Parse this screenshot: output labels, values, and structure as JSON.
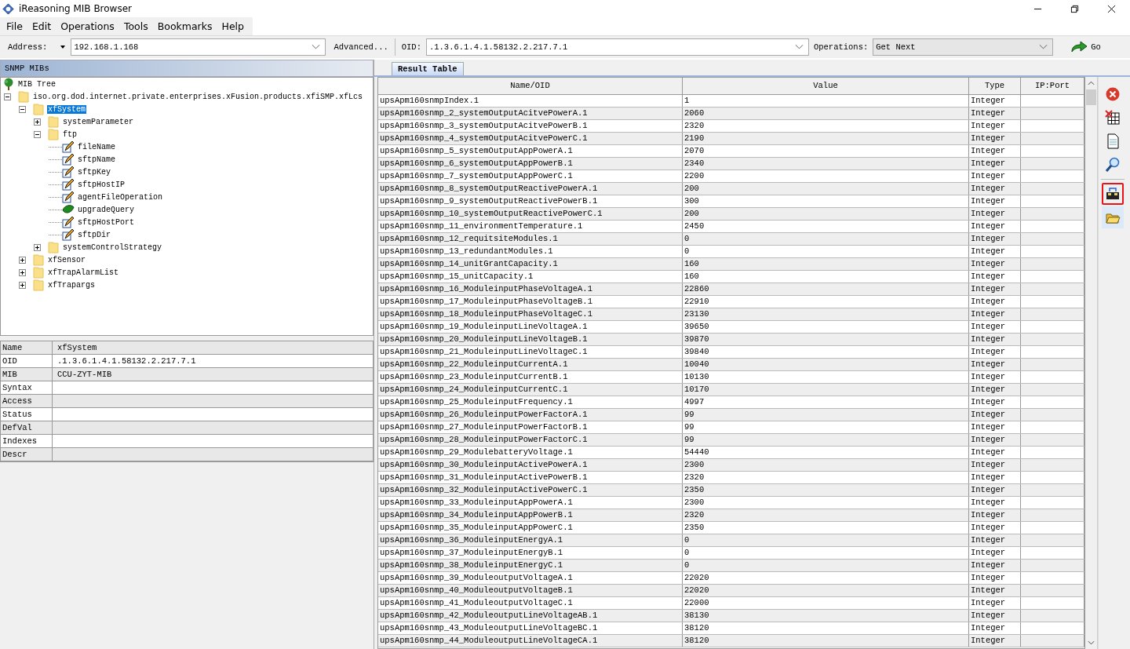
{
  "window": {
    "title": "iReasoning MIB Browser"
  },
  "menu": [
    "File",
    "Edit",
    "Operations",
    "Tools",
    "Bookmarks",
    "Help"
  ],
  "toolbar": {
    "address_label": "Address:",
    "address": "192.168.1.168",
    "advanced": "Advanced...",
    "oid_label": "OID:",
    "oid": ".1.3.6.1.4.1.58132.2.217.7.1",
    "operations_label": "Operations:",
    "operation": "Get Next",
    "go": "Go"
  },
  "mib_panel": {
    "title": "SNMP MIBs",
    "root": "MIB Tree",
    "tree": [
      {
        "label": "iso.org.dod.internet.private.enterprises.xFusion.products.xfiSMP.xfLcs",
        "kind": "folder",
        "expanded": true,
        "selected": false,
        "children": [
          {
            "label": "xfSystem",
            "kind": "folder",
            "expanded": true,
            "selected": true,
            "children": [
              {
                "label": "systemParameter",
                "kind": "folder",
                "expanded": false,
                "selected": false
              },
              {
                "label": "ftp",
                "kind": "folder",
                "expanded": true,
                "selected": false,
                "children": [
                  {
                    "label": "fileName",
                    "kind": "writable",
                    "selected": false
                  },
                  {
                    "label": "sftpName",
                    "kind": "writable",
                    "selected": false
                  },
                  {
                    "label": "sftpKey",
                    "kind": "writable",
                    "selected": false
                  },
                  {
                    "label": "sftpHostIP",
                    "kind": "writable",
                    "selected": false
                  },
                  {
                    "label": "agentFileOperation",
                    "kind": "writable",
                    "selected": false
                  },
                  {
                    "label": "upgradeQuery",
                    "kind": "readonly",
                    "selected": false
                  },
                  {
                    "label": "sftpHostPort",
                    "kind": "writable",
                    "selected": false
                  },
                  {
                    "label": "sftpDir",
                    "kind": "writable",
                    "selected": false
                  }
                ]
              },
              {
                "label": "systemControlStrategy",
                "kind": "folder",
                "expanded": false,
                "selected": false
              }
            ]
          },
          {
            "label": "xfSensor",
            "kind": "folder",
            "expanded": false,
            "selected": false
          },
          {
            "label": "xfTrapAlarmList",
            "kind": "folder",
            "expanded": false,
            "selected": false
          },
          {
            "label": "xfTrapargs",
            "kind": "folder",
            "expanded": false,
            "selected": false
          }
        ]
      }
    ]
  },
  "properties": [
    {
      "name": "Name",
      "value": "xfSystem"
    },
    {
      "name": "OID",
      "value": ".1.3.6.1.4.1.58132.2.217.7.1"
    },
    {
      "name": "MIB",
      "value": "CCU-ZYT-MIB"
    },
    {
      "name": "Syntax"
    },
    {
      "name": "Access"
    },
    {
      "name": "Status"
    },
    {
      "name": "DefVal"
    },
    {
      "name": "Indexes"
    },
    {
      "name": "Descr"
    }
  ],
  "result_tab": {
    "label": "Result Table",
    "selected": true
  },
  "table": {
    "columns": [
      "Name/OID",
      "Value",
      "Type",
      "IP:Port"
    ],
    "rows": [
      [
        "upsApm160snmpIndex.1",
        "1",
        "Integer"
      ],
      [
        "upsApm160snmp_2_systemOutputAcitvePowerA.1",
        "2060",
        "Integer"
      ],
      [
        "upsApm160snmp_3_systemOutputAcitvePowerB.1",
        "2320",
        "Integer"
      ],
      [
        "upsApm160snmp_4_systemOutputAcitvePowerC.1",
        "2190",
        "Integer"
      ],
      [
        "upsApm160snmp_5_systemOutputAppPowerA.1",
        "2070",
        "Integer"
      ],
      [
        "upsApm160snmp_6_systemOutputAppPowerB.1",
        "2340",
        "Integer"
      ],
      [
        "upsApm160snmp_7_systemOutputAppPowerC.1",
        "2200",
        "Integer"
      ],
      [
        "upsApm160snmp_8_systemOutputReactivePowerA.1",
        "200",
        "Integer"
      ],
      [
        "upsApm160snmp_9_systemOutputReactivePowerB.1",
        "300",
        "Integer"
      ],
      [
        "upsApm160snmp_10_systemOutputReactivePowerC.1",
        "200",
        "Integer"
      ],
      [
        "upsApm160snmp_11_environmentTemperature.1",
        "2450",
        "Integer"
      ],
      [
        "upsApm160snmp_12_requitsiteModules.1",
        "0",
        "Integer"
      ],
      [
        "upsApm160snmp_13_redundantModules.1",
        "0",
        "Integer"
      ],
      [
        "upsApm160snmp_14_unitGrantCapacity.1",
        "160",
        "Integer"
      ],
      [
        "upsApm160snmp_15_unitCapacity.1",
        "160",
        "Integer"
      ],
      [
        "upsApm160snmp_16_ModuleinputPhaseVoltageA.1",
        "22860",
        "Integer"
      ],
      [
        "upsApm160snmp_17_ModuleinputPhaseVoltageB.1",
        "22910",
        "Integer"
      ],
      [
        "upsApm160snmp_18_ModuleinputPhaseVoltageC.1",
        "23130",
        "Integer"
      ],
      [
        "upsApm160snmp_19_ModuleinputLineVoltageA.1",
        "39650",
        "Integer"
      ],
      [
        "upsApm160snmp_20_ModuleinputLineVoltageB.1",
        "39870",
        "Integer"
      ],
      [
        "upsApm160snmp_21_ModuleinputLineVoltageC.1",
        "39840",
        "Integer"
      ],
      [
        "upsApm160snmp_22_ModuleinputCurrentA.1",
        "10040",
        "Integer"
      ],
      [
        "upsApm160snmp_23_ModuleinputCurrentB.1",
        "10130",
        "Integer"
      ],
      [
        "upsApm160snmp_24_ModuleinputCurrentC.1",
        "10170",
        "Integer"
      ],
      [
        "upsApm160snmp_25_ModuleinputFrequency.1",
        "4997",
        "Integer"
      ],
      [
        "upsApm160snmp_26_ModuleinputPowerFactorA.1",
        "99",
        "Integer"
      ],
      [
        "upsApm160snmp_27_ModuleinputPowerFactorB.1",
        "99",
        "Integer"
      ],
      [
        "upsApm160snmp_28_ModuleinputPowerFactorC.1",
        "99",
        "Integer"
      ],
      [
        "upsApm160snmp_29_ModulebatteryVoltage.1",
        "54440",
        "Integer"
      ],
      [
        "upsApm160snmp_30_ModuleinputActivePowerA.1",
        "2300",
        "Integer"
      ],
      [
        "upsApm160snmp_31_ModuleinputActivePowerB.1",
        "2320",
        "Integer"
      ],
      [
        "upsApm160snmp_32_ModuleinputActivePowerC.1",
        "2350",
        "Integer"
      ],
      [
        "upsApm160snmp_33_ModuleinputAppPowerA.1",
        "2300",
        "Integer"
      ],
      [
        "upsApm160snmp_34_ModuleinputAppPowerB.1",
        "2320",
        "Integer"
      ],
      [
        "upsApm160snmp_35_ModuleinputAppPowerC.1",
        "2350",
        "Integer"
      ],
      [
        "upsApm160snmp_36_ModuleinputEnergyA.1",
        "0",
        "Integer"
      ],
      [
        "upsApm160snmp_37_ModuleinputEnergyB.1",
        "0",
        "Integer"
      ],
      [
        "upsApm160snmp_38_ModuleinputEnergyC.1",
        "0",
        "Integer"
      ],
      [
        "upsApm160snmp_39_ModuleoutputVoltageA.1",
        "22020",
        "Integer"
      ],
      [
        "upsApm160snmp_40_ModuleoutputVoltageB.1",
        "22020",
        "Integer"
      ],
      [
        "upsApm160snmp_41_ModuleoutputVoltageC.1",
        "22000",
        "Integer"
      ],
      [
        "upsApm160snmp_42_ModuleoutputLineVoltageAB.1",
        "38130",
        "Integer"
      ],
      [
        "upsApm160snmp_43_ModuleoutputLineVoltageBC.1",
        "38120",
        "Integer"
      ],
      [
        "upsApm160snmp_44_ModuleoutputLineVoltageCA.1",
        "38120",
        "Integer"
      ]
    ]
  },
  "side_tools": [
    {
      "kind": "stop",
      "highlighted": false
    },
    {
      "kind": "clear",
      "highlighted": false
    },
    {
      "kind": "save",
      "highlighted": false
    },
    {
      "kind": "find",
      "highlighted": false
    },
    {
      "kind": "export",
      "highlighted": true
    },
    {
      "kind": "open",
      "highlighted": false
    }
  ]
}
